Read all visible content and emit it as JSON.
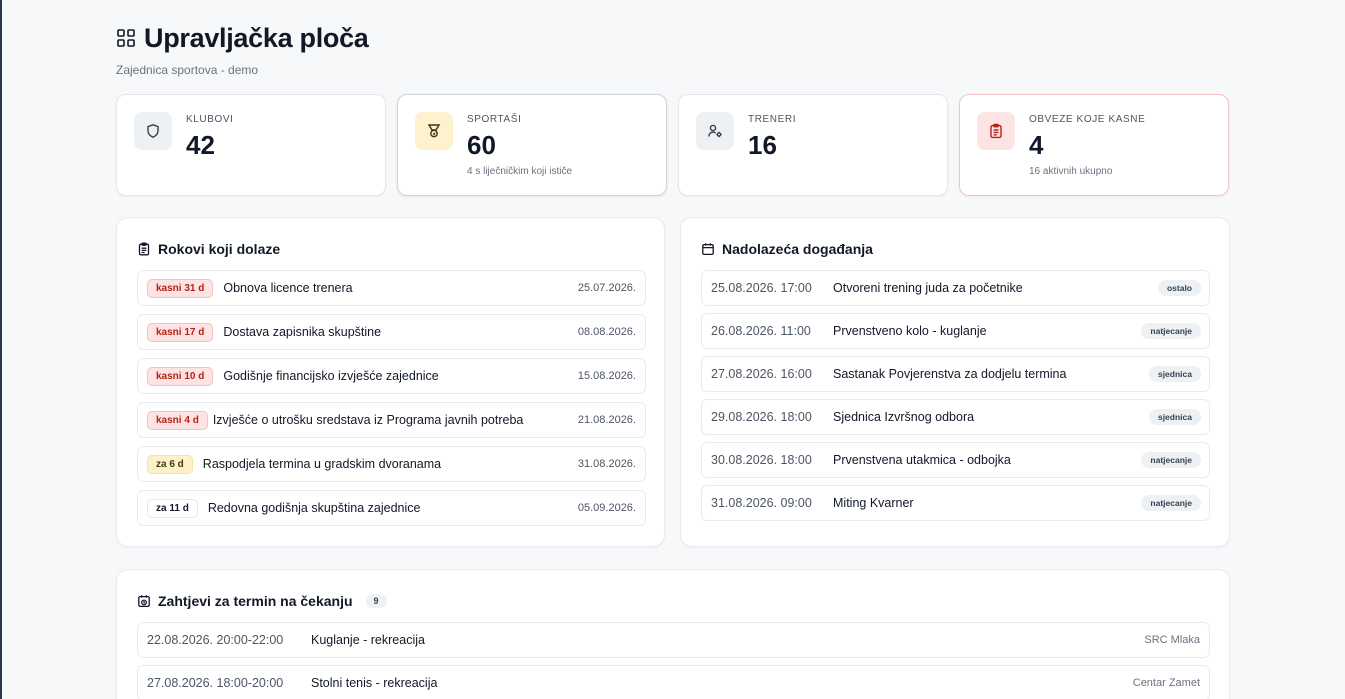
{
  "header": {
    "title": "Upravljačka ploča",
    "subtitle": "Zajednica sportova - demo"
  },
  "stats": [
    {
      "label": "KLUBOVI",
      "value": "42",
      "note": "",
      "icon": "shield-icon"
    },
    {
      "label": "SPORTAŠI",
      "value": "60",
      "note": "4 s liječničkim koji ističe",
      "icon": "medal-icon"
    },
    {
      "label": "TRENERI",
      "value": "16",
      "note": "",
      "icon": "user-cog-icon"
    },
    {
      "label": "OBVEZE KOJE KASNE",
      "value": "4",
      "note": "16 aktivnih ukupno",
      "icon": "clipboard-icon"
    }
  ],
  "deadlines": {
    "title": "Rokovi koji dolaze",
    "items": [
      {
        "badge": "kasni 31 d",
        "status": "late",
        "text": "Obnova licence trenera",
        "date": "25.07.2026."
      },
      {
        "badge": "kasni 17 d",
        "status": "late",
        "text": "Dostava zapisnika skupštine",
        "date": "08.08.2026."
      },
      {
        "badge": "kasni 10 d",
        "status": "late",
        "text": "Godišnje financijsko izvješće zajednice",
        "date": "15.08.2026."
      },
      {
        "badge": "kasni 4 d",
        "status": "late",
        "text": "Izvješće o utrošku sredstava iz Programa javnih potreba",
        "date": "21.08.2026."
      },
      {
        "badge": "za 6 d",
        "status": "soon",
        "text": "Raspodjela termina u gradskim dvoranama",
        "date": "31.08.2026."
      },
      {
        "badge": "za 11 d",
        "status": "neutral",
        "text": "Redovna godišnja skupština zajednice",
        "date": "05.09.2026."
      }
    ]
  },
  "events": {
    "title": "Nadolazeća događanja",
    "items": [
      {
        "datetime": "25.08.2026. 17:00",
        "title": "Otvoreni trening juda za početnike",
        "tag": "ostalo"
      },
      {
        "datetime": "26.08.2026. 11:00",
        "title": "Prvenstveno kolo - kuglanje",
        "tag": "natjecanje"
      },
      {
        "datetime": "27.08.2026. 16:00",
        "title": "Sastanak Povjerenstva za dodjelu termina",
        "tag": "sjednica"
      },
      {
        "datetime": "29.08.2026. 18:00",
        "title": "Sjednica Izvršnog odbora",
        "tag": "sjednica"
      },
      {
        "datetime": "30.08.2026. 18:00",
        "title": "Prvenstvena utakmica - odbojka",
        "tag": "natjecanje"
      },
      {
        "datetime": "31.08.2026. 09:00",
        "title": "Miting Kvarner",
        "tag": "natjecanje"
      }
    ]
  },
  "requests": {
    "title": "Zahtjevi za termin na čekanju",
    "count": "9",
    "items": [
      {
        "range": "22.08.2026. 20:00-22:00",
        "activity": "Kuglanje - rekreacija",
        "place": "SRC Mlaka"
      },
      {
        "range": "27.08.2026. 18:00-20:00",
        "activity": "Stolni tenis - rekreacija",
        "place": "Centar Zamet"
      }
    ]
  },
  "colors": {
    "late_badge_bg": "#fde3e3",
    "late_badge_text": "#b42318",
    "soon_badge_bg": "#fdf1c7",
    "danger_icon_bg": "#fde4e4",
    "medal_icon_bg": "#fdf2cd"
  }
}
